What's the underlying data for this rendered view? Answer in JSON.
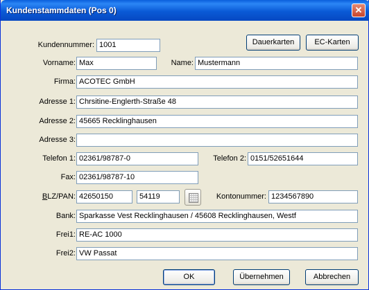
{
  "window": {
    "title": "Kundenstammdaten (Pos 0)",
    "close_glyph": "✕"
  },
  "buttons": {
    "dauerkarten": "Dauerkarten",
    "ec_karten": "EC-Karten",
    "ok": "OK",
    "uebernehmen": "Übernehmen",
    "abbrechen": "Abbrechen"
  },
  "fields": {
    "kundennummer": {
      "label": "Kundennummer:",
      "value": "1001"
    },
    "vorname": {
      "label": "Vorname:",
      "value": "Max"
    },
    "name": {
      "label": "Name:",
      "value": "Mustermann"
    },
    "firma": {
      "label": "Firma:",
      "value": "ACOTEC GmbH"
    },
    "adresse1": {
      "label": "Adresse 1:",
      "value": "Chrsitine-Englerth-Straße 48"
    },
    "adresse2": {
      "label": "Adresse 2:",
      "value": "45665 Recklinghausen"
    },
    "adresse3": {
      "label": "Adresse 3:",
      "value": ""
    },
    "telefon1": {
      "label": "Telefon 1:",
      "value": "02361/98787-0"
    },
    "telefon2": {
      "label": "Telefon 2:",
      "value": "0151/52651644"
    },
    "fax": {
      "label": "Fax:",
      "value": "02361/98787-10"
    },
    "blz_pan": {
      "label_first": "B",
      "label_rest": "LZ/PAN:",
      "blz_value": "42650150",
      "pan_value": "54119"
    },
    "kontonummer": {
      "label": "Kontonummer:",
      "value": "1234567890"
    },
    "bank": {
      "label": "Bank:",
      "value": "Sparkasse Vest Recklinghausen / 45608 Recklinghausen, Westf"
    },
    "frei1": {
      "label": "Frei1:",
      "value": "RE-AC 1000"
    },
    "frei2": {
      "label": "Frei2:",
      "value": "VW Passat"
    }
  },
  "icons": {
    "bank_lookup": "grid-icon"
  }
}
